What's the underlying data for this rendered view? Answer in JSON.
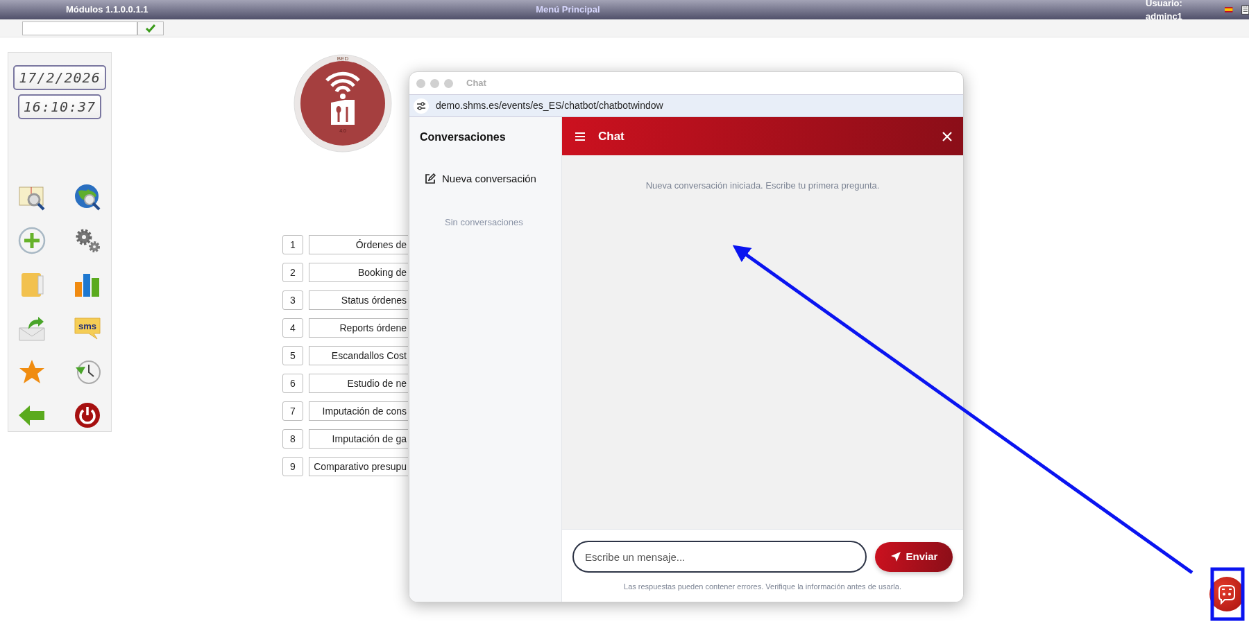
{
  "top_bar": {
    "version": "Módulos 1.1.0.0.1.1",
    "title": "Menú Principal",
    "user": "Usuario: adminc1"
  },
  "left_panel": {
    "date": "17/2/2026",
    "time": "16:10:37",
    "sms_label": "sms"
  },
  "logo": {
    "top_text": "BED",
    "bottom_text": "4.0"
  },
  "menu": [
    {
      "number": "1",
      "label": "Órdenes de"
    },
    {
      "number": "2",
      "label": "Booking de"
    },
    {
      "number": "3",
      "label": "Status órdenes"
    },
    {
      "number": "4",
      "label": "Reports órdene"
    },
    {
      "number": "5",
      "label": "Escandallos Cost"
    },
    {
      "number": "6",
      "label": "Estudio de ne"
    },
    {
      "number": "7",
      "label": "Imputación de cons"
    },
    {
      "number": "8",
      "label": "Imputación de ga"
    },
    {
      "number": "9",
      "label": "Comparativo presupu"
    }
  ],
  "chat_window": {
    "title": "Chat",
    "url": "demo.shms.es/events/es_ES/chatbot/chatbotwindow",
    "sidebar": {
      "heading": "Conversaciones",
      "new_button": "Nueva conversación",
      "empty": "Sin conversaciones"
    },
    "header": "Chat",
    "system_message": "Nueva conversación iniciada. Escribe tu primera pregunta.",
    "input": {
      "placeholder": "Escribe un mensaje..."
    },
    "send_button": "Enviar",
    "disclaimer": "Las respuestas pueden contener errores. Verifique la información antes de usarla."
  }
}
